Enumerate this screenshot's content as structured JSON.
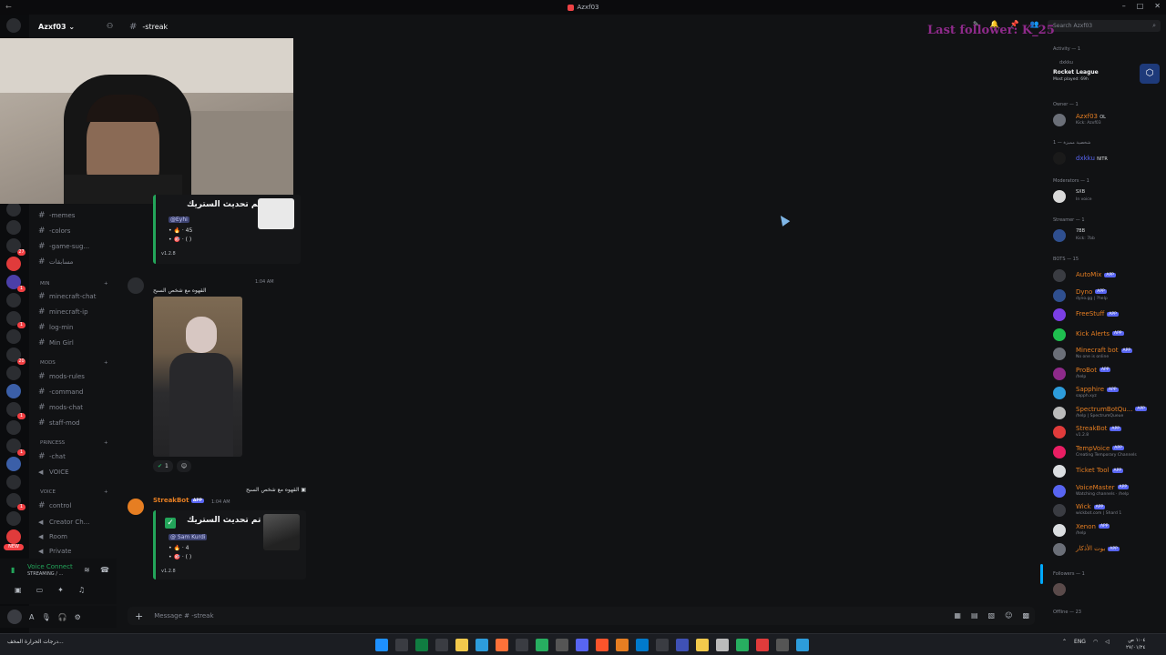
{
  "window": {
    "title": "Azxf03"
  },
  "server": {
    "name": "Azxf03 ⌄"
  },
  "rail": {
    "badges": [
      "27",
      "1",
      "1",
      "20",
      "1",
      "1",
      "1"
    ],
    "new_label": "NEW"
  },
  "channels": [
    {
      "name": "-memes",
      "type": "text"
    },
    {
      "name": "-colors",
      "type": "text"
    },
    {
      "name": "-game-sug...",
      "type": "text"
    },
    {
      "name": "مسابقات",
      "type": "text"
    },
    {
      "name": "minecraft-chat",
      "type": "text"
    },
    {
      "name": "minecraft-ip",
      "type": "text"
    },
    {
      "name": "log-min",
      "type": "text"
    },
    {
      "name": "Min Girl",
      "type": "text"
    },
    {
      "name": "mods-rules",
      "type": "text"
    },
    {
      "name": "-command",
      "type": "text"
    },
    {
      "name": "mods-chat",
      "type": "text"
    },
    {
      "name": "staff-mod",
      "type": "text"
    },
    {
      "name": "-chat",
      "type": "text"
    },
    {
      "name": "VOICE",
      "type": "voice"
    },
    {
      "name": "control",
      "type": "text"
    },
    {
      "name": "Creator Ch...",
      "type": "voice"
    },
    {
      "name": "Room",
      "type": "voice"
    },
    {
      "name": "Private",
      "type": "voice"
    }
  ],
  "categories": {
    "min": "Min",
    "mods": "Mods",
    "princess": "PRINCESS",
    "voice": "VOICE"
  },
  "voice_panel": {
    "title": "Voice Connect",
    "subtitle": "STREAMING / ..."
  },
  "chat": {
    "channel": "-streak",
    "last_follower": "Last follower: K_25",
    "search_placeholder": "Search Azxf03",
    "composer_placeholder": "Message # -streak"
  },
  "messages": {
    "embed1": {
      "title": "تم تحديث الستريك",
      "mention": "@Eyhi",
      "line1": "45",
      "line2": "(  )",
      "footer": "v1.2.8"
    },
    "msg2": {
      "time": "1:04 AM",
      "text": "القهوه مع شخص السبح"
    },
    "reaction_count": "1",
    "reply": {
      "text": "القهوه مع شخص السبح"
    },
    "msg3": {
      "author": "StreakBot",
      "tag": "APP",
      "time": "1:04 AM"
    },
    "embed2": {
      "title": "تم تحديث الستريك",
      "mention": "@ Sam Kurdi",
      "line1": "4",
      "line2": "(  )",
      "footer": "v1.2.8"
    }
  },
  "members": {
    "activity_label": "Activity — 1",
    "activity": {
      "user": "dxkku",
      "game": "Rocket League",
      "sub": "Most played: 69h"
    },
    "owner_label": "Owner — 1",
    "owner": {
      "name": "Azxf03",
      "tag": "OL",
      "sub": "Kick: Azxf03"
    },
    "special_label": "شخصية مميزة — 1",
    "special": {
      "name": "dxkku",
      "tag": "NITR"
    },
    "mods_label": "Moderators — 1",
    "mod": {
      "name": "SXB",
      "sub": "In voice"
    },
    "streamer_label": "Streamer — 1",
    "streamer": {
      "name": "7BB",
      "sub": "Kick: 7bb"
    },
    "bots_label": "BOTS — 15",
    "bots": [
      {
        "name": "AutoMix",
        "sub": "",
        "color": "#e67e22"
      },
      {
        "name": "Dyno",
        "sub": "dyno.gg | ?help",
        "color": "#e67e22"
      },
      {
        "name": "FreeStuff",
        "sub": "",
        "color": "#e67e22"
      },
      {
        "name": "Kick Alerts",
        "sub": "",
        "color": "#e67e22"
      },
      {
        "name": "Minecraft bot",
        "sub": "No one is online",
        "color": "#e67e22"
      },
      {
        "name": "ProBot",
        "sub": "/help",
        "color": "#e67e22"
      },
      {
        "name": "Sapphire",
        "sub": "sapph.xyz",
        "color": "#e67e22"
      },
      {
        "name": "SpectrumBotQu...",
        "sub": "/help | SpectrumQueue",
        "color": "#e67e22"
      },
      {
        "name": "StreakBot",
        "sub": "v1.2.8",
        "color": "#e67e22"
      },
      {
        "name": "TempVoice",
        "sub": "Creating Temporary Channels",
        "color": "#e67e22"
      },
      {
        "name": "Ticket Tool",
        "sub": "",
        "color": "#e67e22"
      },
      {
        "name": "VoiceMaster",
        "sub": "Watching channels · /help",
        "color": "#e67e22"
      },
      {
        "name": "Wick",
        "sub": "wickbot.com | Shard 1",
        "color": "#e67e22"
      },
      {
        "name": "Xenon",
        "sub": "/help",
        "color": "#e67e22"
      },
      {
        "name": "بوت الأذكار",
        "sub": "",
        "color": "#e67e22"
      }
    ],
    "app_tag": "APP",
    "followers_label": "Followers — 1",
    "offline_label": "Offline — 23"
  },
  "taskbar": {
    "weather": "درجات الحرارة المخف...",
    "lang": "ENG",
    "time": "١:٠٤ ص",
    "date": "٢٧/٠١/٢٤"
  },
  "colors": {
    "accent": "#5865f2",
    "green": "#23a55a",
    "bot_name": "#e67e22",
    "follower": "#8e2a8a"
  }
}
